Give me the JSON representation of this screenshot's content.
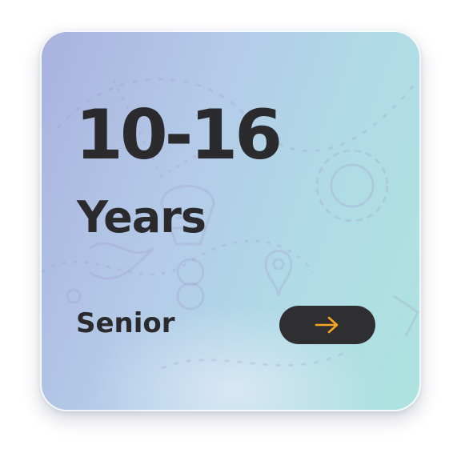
{
  "card": {
    "age_range": "10-16",
    "age_unit": "Years",
    "level": "Senior",
    "action_icon": "arrow-right-icon"
  },
  "colors": {
    "text": "#2b2b2d",
    "button_bg": "#2f2f31",
    "arrow": "#f5a623",
    "gradient_start": "#a9b2de",
    "gradient_end": "#aee3df"
  }
}
